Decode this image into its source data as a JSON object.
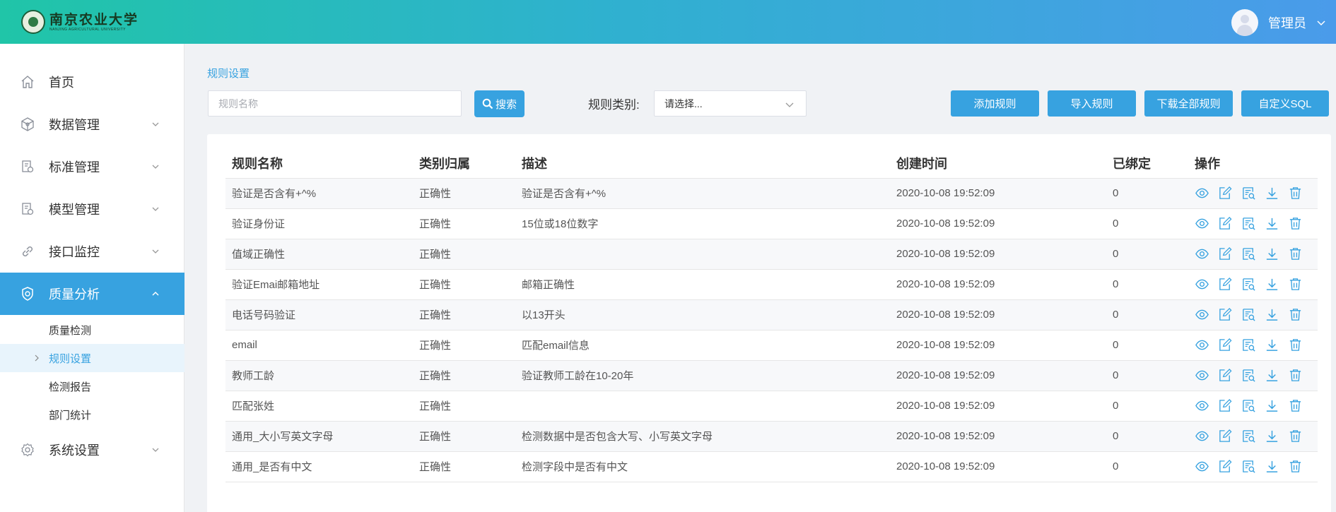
{
  "header": {
    "logo_cn": "南京农业大学",
    "logo_en": "NANJING AGRICULTURAL UNIVERSITY",
    "user_name": "管理员"
  },
  "sidebar": {
    "items": [
      {
        "label": "首页"
      },
      {
        "label": "数据管理"
      },
      {
        "label": "标准管理"
      },
      {
        "label": "模型管理"
      },
      {
        "label": "接口监控"
      },
      {
        "label": "质量分析"
      },
      {
        "label": "系统设置"
      }
    ],
    "sub_items": [
      {
        "label": "质量检测"
      },
      {
        "label": "规则设置"
      },
      {
        "label": "检测报告"
      },
      {
        "label": "部门统计"
      }
    ]
  },
  "content": {
    "breadcrumb": "规则设置",
    "search_placeholder": "规则名称",
    "search_button": "搜索",
    "filter_label": "规则类别:",
    "select_value": "请选择...",
    "actions": {
      "add": "添加规则",
      "import": "导入规则",
      "download_all": "下载全部规则",
      "custom_sql": "自定义SQL"
    }
  },
  "table": {
    "columns": [
      "规则名称",
      "类别归属",
      "描述",
      "创建时间",
      "已绑定",
      "操作"
    ],
    "rows": [
      {
        "name": "验证是否含有+^%",
        "category": "正确性",
        "desc": "验证是否含有+^%",
        "created": "2020-10-08 19:52:09",
        "bound": "0"
      },
      {
        "name": "验证身份证",
        "category": "正确性",
        "desc": "15位或18位数字",
        "created": "2020-10-08 19:52:09",
        "bound": "0"
      },
      {
        "name": "值域正确性",
        "category": "正确性",
        "desc": "",
        "created": "2020-10-08 19:52:09",
        "bound": "0"
      },
      {
        "name": "验证Emai邮箱地址",
        "category": "正确性",
        "desc": "邮箱正确性",
        "created": "2020-10-08 19:52:09",
        "bound": "0"
      },
      {
        "name": "电话号码验证",
        "category": "正确性",
        "desc": "以13开头",
        "created": "2020-10-08 19:52:09",
        "bound": "0"
      },
      {
        "name": "email",
        "category": "正确性",
        "desc": "匹配email信息",
        "created": "2020-10-08 19:52:09",
        "bound": "0"
      },
      {
        "name": "教师工龄",
        "category": "正确性",
        "desc": "验证教师工龄在10-20年",
        "created": "2020-10-08 19:52:09",
        "bound": "0"
      },
      {
        "name": "匹配张姓",
        "category": "正确性",
        "desc": "",
        "created": "2020-10-08 19:52:09",
        "bound": "0"
      },
      {
        "name": "通用_大小写英文字母",
        "category": "正确性",
        "desc": "检测数据中是否包含大写、小写英文字母",
        "created": "2020-10-08 19:52:09",
        "bound": "0"
      },
      {
        "name": "通用_是否有中文",
        "category": "正确性",
        "desc": "检测字段中是否有中文",
        "created": "2020-10-08 19:52:09",
        "bound": "0"
      }
    ],
    "row_icons": [
      "eye-icon",
      "edit-icon",
      "detail-icon",
      "download-icon",
      "trash-icon"
    ]
  },
  "colors": {
    "accent": "#37a2e0",
    "header_gradient_start": "#20c5a8",
    "header_gradient_end": "#4a9bea"
  }
}
